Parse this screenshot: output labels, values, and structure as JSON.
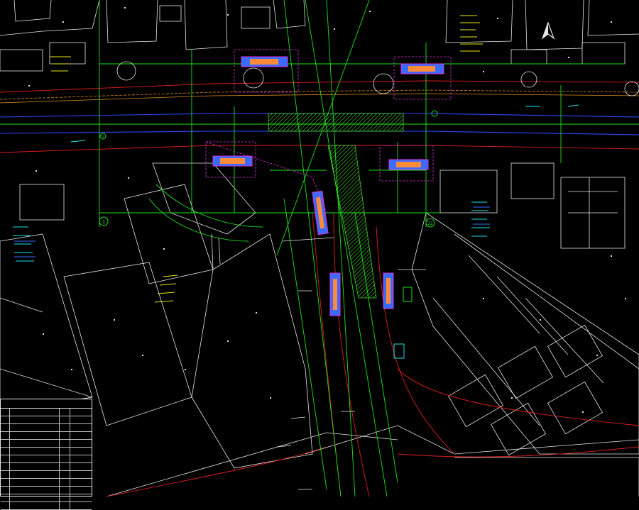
{
  "drawing": {
    "background": "#000000",
    "colors": {
      "building_outline": "#e6e6e6",
      "alignment": "#19e619",
      "road_centerline_blue": "#2e46ff",
      "road_edge_red": "#e01e1e",
      "pipe_orange": "#e08a1e",
      "station_box": "#3a6bff",
      "station_fill": "#ff8a3a",
      "entrance_magenta": "#e02ee0",
      "hatch_green": "#4ad62e",
      "annotation_yellow": "#e6e619",
      "annotation_cyan": "#19e6e6"
    },
    "axis_markers": [
      "1",
      "1",
      "22"
    ]
  },
  "legend_table": {
    "rows": 13
  },
  "icons": {
    "north_arrow": "north-arrow-icon"
  }
}
